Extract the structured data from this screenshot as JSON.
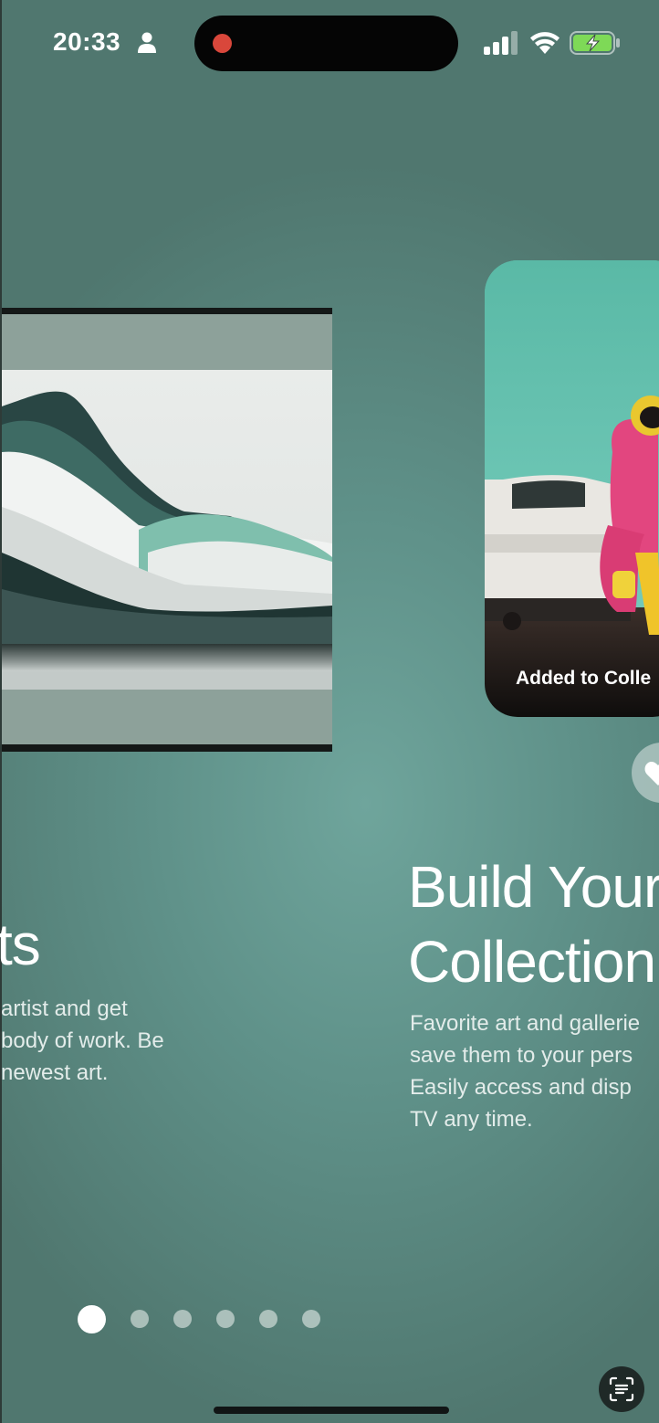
{
  "status_bar": {
    "time": "20:33",
    "icons": [
      "person-icon",
      "recording-dot",
      "cellular-signal-icon",
      "wifi-icon",
      "battery-charging-icon"
    ]
  },
  "slides": [
    {
      "title_visible": "ts",
      "body_lines": [
        "artist and get",
        "body of work. Be",
        "newest art."
      ],
      "image": "abstract-landscape-artwork"
    },
    {
      "title_lines": [
        "Build Your",
        "Collection"
      ],
      "body_lines": [
        "Favorite art and gallerie",
        "save them to your pers",
        "Easily access and disp",
        "TV any time."
      ],
      "card_label": "Added to Colle",
      "image": "astronaut-with-car-artwork"
    }
  ],
  "pagination": {
    "total": 6,
    "active_index": 0
  },
  "colors": {
    "background": "#5f9189",
    "card_teal": "#5ebaa8",
    "record_dot": "#d9473b"
  }
}
